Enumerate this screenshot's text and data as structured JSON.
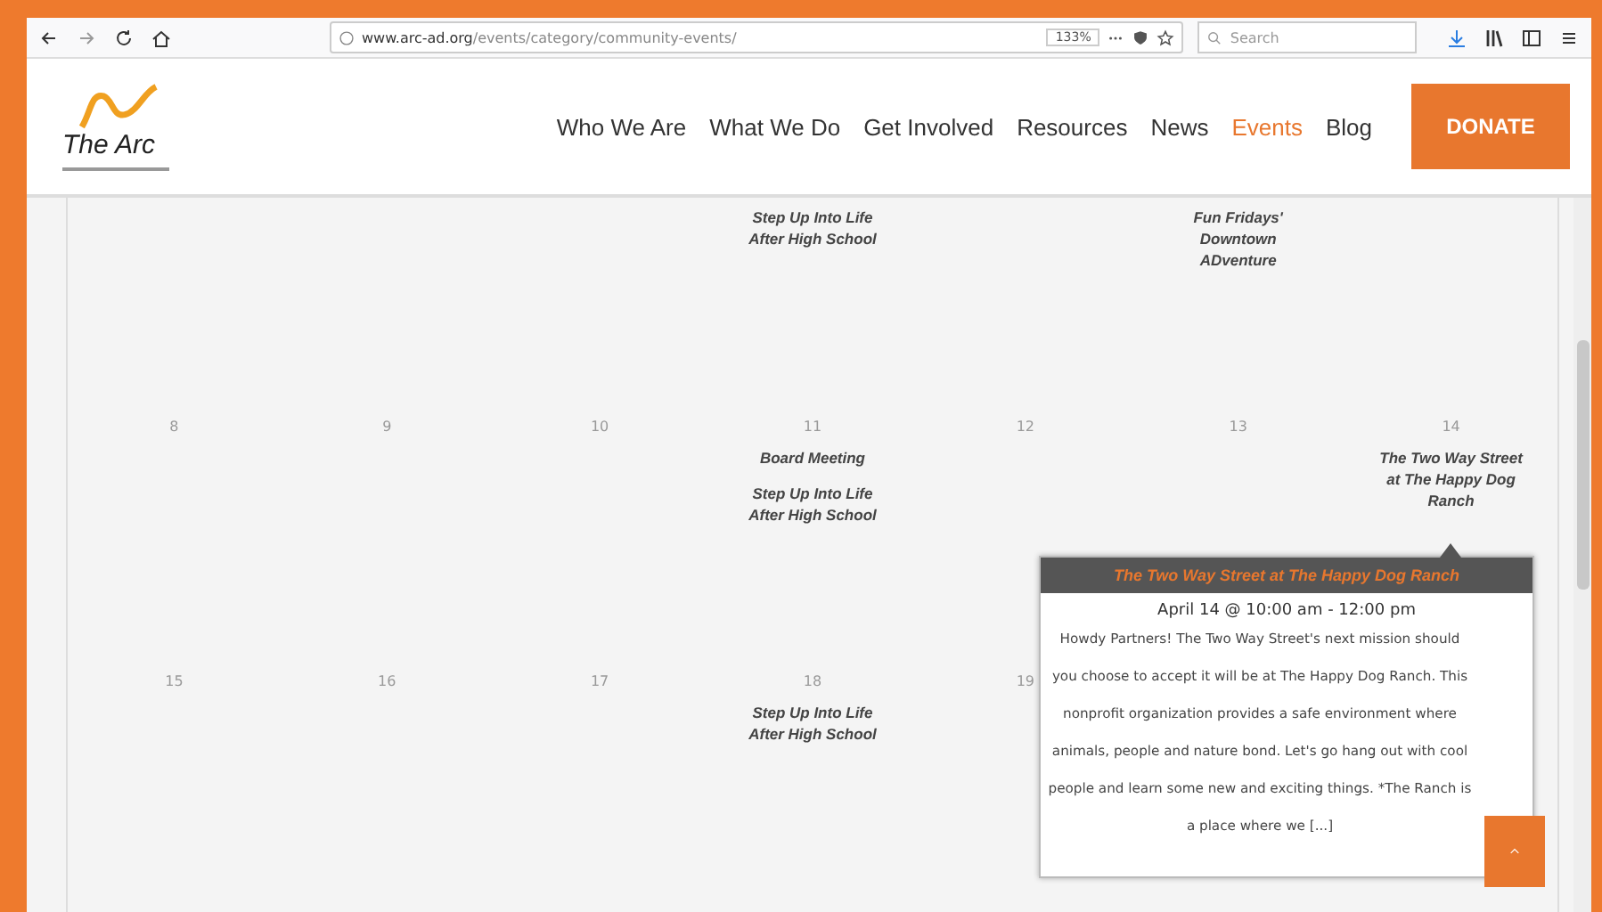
{
  "browser": {
    "url_host": "www.arc-ad.org",
    "url_path": "/events/category/community-events/",
    "zoom": "133%",
    "search_placeholder": "Search"
  },
  "site": {
    "logo_text": "The Arc",
    "nav": [
      {
        "label": "Who We Are",
        "selected": false
      },
      {
        "label": "What We Do",
        "selected": false
      },
      {
        "label": "Get Involved",
        "selected": false
      },
      {
        "label": "Resources",
        "selected": false
      },
      {
        "label": "News",
        "selected": false
      },
      {
        "label": "Events",
        "selected": true
      },
      {
        "label": "Blog",
        "selected": false
      }
    ],
    "donate": "DONATE"
  },
  "calendar": {
    "weeks": [
      {
        "days": [
          {
            "kind": "blank"
          },
          {
            "kind": "blank"
          },
          {
            "kind": "blank"
          },
          {
            "kind": "day",
            "events": [
              "Step Up Into Life After High School"
            ]
          },
          {
            "kind": "blank"
          },
          {
            "kind": "day",
            "events": [
              "Fun Fridays' Downtown ADventure"
            ]
          },
          {
            "kind": "blank"
          }
        ]
      },
      {
        "days": [
          {
            "date": "8"
          },
          {
            "date": "9"
          },
          {
            "date": "10"
          },
          {
            "date": "11",
            "events": [
              "Board Meeting",
              "Step Up Into Life After High School"
            ]
          },
          {
            "date": "12"
          },
          {
            "date": "13"
          },
          {
            "date": "14",
            "events": [
              "The Two Way Street at The Happy Dog Ranch"
            ]
          }
        ]
      },
      {
        "days": [
          {
            "date": "15"
          },
          {
            "date": "16"
          },
          {
            "date": "17"
          },
          {
            "date": "18",
            "events": [
              "Step Up Into Life After High School"
            ]
          },
          {
            "date": "19"
          },
          {
            "kind": "blank"
          },
          {
            "kind": "blank"
          }
        ]
      }
    ]
  },
  "popup": {
    "title": "The Two Way Street at The Happy Dog Ranch",
    "time": "April 14 @ 10:00 am - 12:00 pm",
    "description": "Howdy Partners! The Two Way Street's next mission should you choose to accept it will be at The Happy Dog Ranch. This nonprofit organization provides a safe environment where animals, people and nature bond. Let's go hang out with cool people and learn some new and exciting things. *The Ranch is a place where we [...]"
  }
}
